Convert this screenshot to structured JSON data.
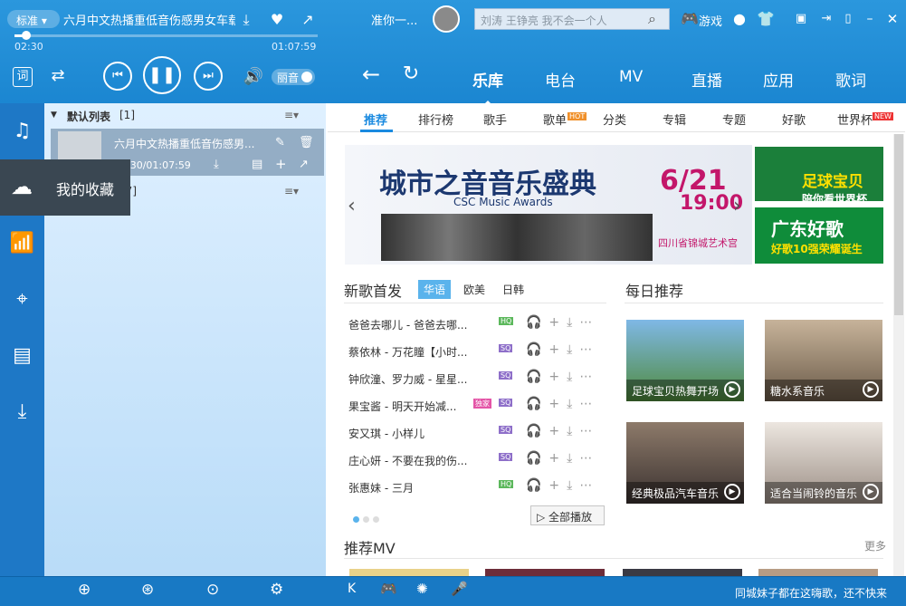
{
  "player": {
    "quality": "标准",
    "track_title": "六月中文热播重低音伤感男女车载慢挂",
    "time_elapsed": "02:30",
    "time_total": "01:07:59",
    "progress": 0.04,
    "sound_mode": "丽音"
  },
  "header": {
    "now_playing": "准你一...",
    "search_placeholder": "刘涛 王铮亮 我不会一个人",
    "game_label": "游戏"
  },
  "nav": {
    "tabs": [
      "乐库",
      "电台",
      "MV",
      "直播",
      "应用",
      "歌词"
    ],
    "active": "乐库"
  },
  "sidebar": {
    "tooltip": "我的收藏"
  },
  "playlist": {
    "header": "默认列表",
    "count": "[1]",
    "second_count": "[7]",
    "song_title": "六月中文热播重低音伤感男...",
    "song_time": "02:30/01:07:59"
  },
  "subtabs": {
    "items": [
      "推荐",
      "排行榜",
      "歌手",
      "歌单",
      "分类",
      "专辑",
      "专题",
      "好歌",
      "世界杯"
    ],
    "hot_badge": "HOT",
    "new_badge": "NEW"
  },
  "banner": {
    "title": "城市之音音乐盛典",
    "subtitle": "CSC Music Awards",
    "date": "6/21",
    "time": "19:00",
    "venue": "四川省锦城艺术宫"
  },
  "ads": {
    "ad1": "足球宝贝",
    "ad1_sub": "陪你看世界杯",
    "ad2": "广东好歌",
    "ad2_sub": "好歌10强荣耀诞生"
  },
  "new_songs": {
    "title": "新歌首发",
    "tabs": [
      "华语",
      "欧美",
      "日韩"
    ],
    "items": [
      {
        "name": "爸爸去哪儿 - 爸爸去哪...",
        "tag": "HQ",
        "tag2": ""
      },
      {
        "name": "蔡依林 - 万花瞳【小时...",
        "tag": "SQ",
        "tag2": ""
      },
      {
        "name": "钟欣潼、罗力威 - 星星...",
        "tag": "SQ",
        "tag2": ""
      },
      {
        "name": "果宝酱 - 明天开始减...",
        "tag": "SQ",
        "tag2": "独家"
      },
      {
        "name": "安又琪 - 小样儿",
        "tag": "SQ",
        "tag2": ""
      },
      {
        "name": "庄心妍 - 不要在我的伤...",
        "tag": "SQ",
        "tag2": ""
      },
      {
        "name": "张惠妹 - 三月",
        "tag": "HQ",
        "tag2": ""
      }
    ],
    "play_all": "全部播放"
  },
  "daily": {
    "title": "每日推荐",
    "cards": [
      "足球宝贝热舞开场",
      "糖水系音乐",
      "经典极品汽车音乐",
      "适合当闹铃的音乐"
    ]
  },
  "mv": {
    "title": "推荐MV",
    "more": "更多"
  },
  "footer": {
    "status": "同城妹子都在这嗨歌，还不快来"
  },
  "colors": {
    "accent": "#1a8ae0",
    "sidebar": "#1e78c6",
    "hot": "#f0902a",
    "new": "#e33333"
  }
}
